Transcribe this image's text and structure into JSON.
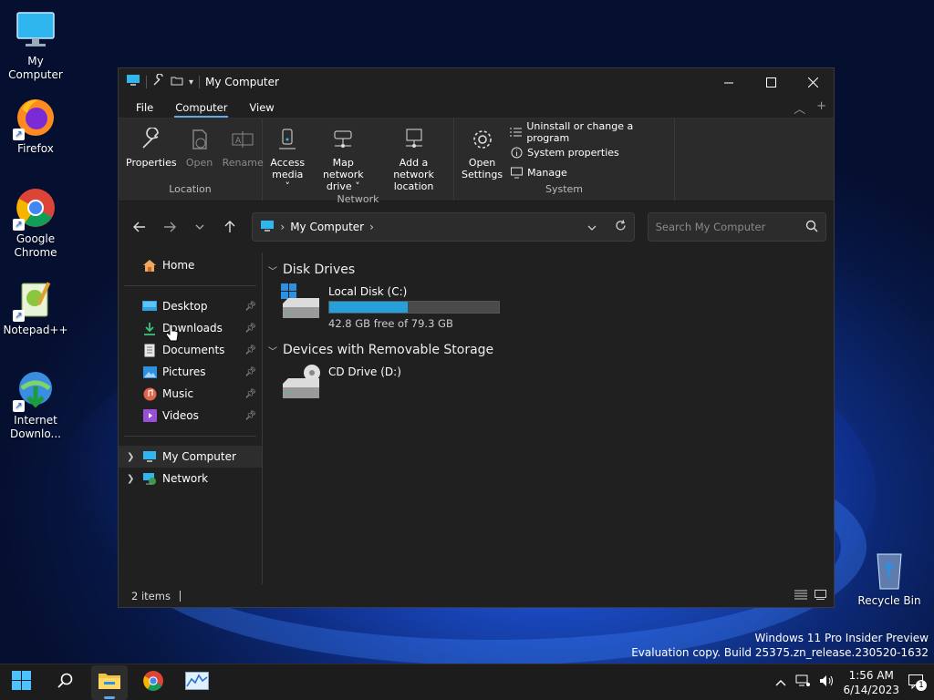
{
  "desktop": {
    "icons": [
      {
        "label": "My Computer"
      },
      {
        "label": "Firefox"
      },
      {
        "label": "Google Chrome"
      },
      {
        "label": "Notepad++"
      },
      {
        "label": "Internet Downlo..."
      },
      {
        "label": "Recycle Bin"
      }
    ],
    "watermark_line1": "Windows 11 Pro Insider Preview",
    "watermark_line2": "Evaluation copy. Build 25375.zn_release.230520-1632"
  },
  "window": {
    "title": "My Computer",
    "tabs": [
      "File",
      "Computer",
      "View"
    ],
    "active_tab": "Computer",
    "ribbon": {
      "location": {
        "name": "Location",
        "properties": "Properties",
        "open": "Open",
        "rename": "Rename"
      },
      "network": {
        "name": "Network",
        "access_media_1": "Access",
        "access_media_2": "media ˅",
        "map_drive_1": "Map network",
        "map_drive_2": "drive ˅",
        "add_location_1": "Add a network",
        "add_location_2": "location"
      },
      "system": {
        "name": "System",
        "open_settings_1": "Open",
        "open_settings_2": "Settings",
        "uninstall": "Uninstall or change a program",
        "system_properties": "System properties",
        "manage": "Manage"
      }
    },
    "address": {
      "crumb": "My Computer",
      "search_placeholder": "Search My Computer"
    },
    "nav": {
      "home": "Home",
      "quick": [
        "Desktop",
        "Downloads",
        "Documents",
        "Pictures",
        "Music",
        "Videos"
      ],
      "my_computer": "My Computer",
      "network": "Network"
    },
    "content": {
      "section_disk": "Disk Drives",
      "disk_name": "Local Disk (C:)",
      "disk_free": "42.8 GB free of 79.3 GB",
      "disk_used_fraction": 0.46,
      "section_removable": "Devices with Removable Storage",
      "cd_name": "CD Drive (D:)"
    },
    "status": {
      "items": "2 items"
    }
  },
  "taskbar": {
    "time": "1:56 AM",
    "date": "6/14/2023",
    "notification_count": "1"
  },
  "colors": {
    "accent": "#60a8f0",
    "progress": "#26a0da",
    "window_bg": "#202020"
  }
}
